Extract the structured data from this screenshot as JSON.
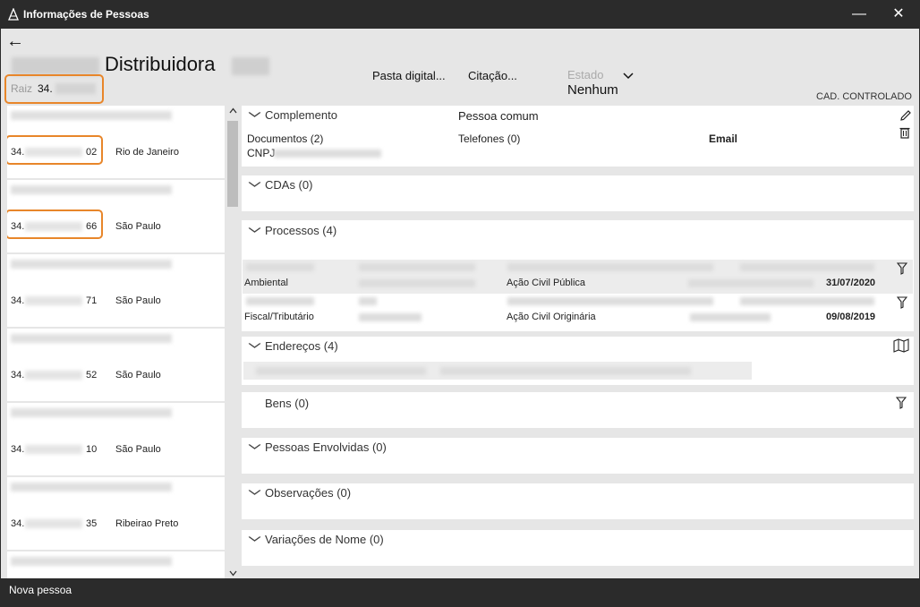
{
  "window": {
    "title": "Informações de Pessoas",
    "minimize_glyph": "—",
    "close_glyph": "✕"
  },
  "header": {
    "back_glyph": "←",
    "company_name_visible": "Distribuidora",
    "raiz_label": "Raiz",
    "raiz_value": "34."
  },
  "toolbar": {
    "pasta_digital": "Pasta digital...",
    "citacao": "Citação...",
    "estado_label": "Estado",
    "estado_value": "Nenhum",
    "cad_label": "CAD. CONTROLADO"
  },
  "list": {
    "items": [
      {
        "cnpj_prefix": "34.",
        "cnpj_suffix": "02",
        "city": "Rio de Janeiro",
        "highlighted": true
      },
      {
        "cnpj_prefix": "34.",
        "cnpj_suffix": "66",
        "city": "São Paulo",
        "highlighted": true
      },
      {
        "cnpj_prefix": "34.",
        "cnpj_suffix": "71",
        "city": "São Paulo",
        "highlighted": false
      },
      {
        "cnpj_prefix": "34.",
        "cnpj_suffix": "52",
        "city": "São Paulo",
        "highlighted": false
      },
      {
        "cnpj_prefix": "34.",
        "cnpj_suffix": "10",
        "city": "São Paulo",
        "highlighted": false
      },
      {
        "cnpj_prefix": "34.",
        "cnpj_suffix": "35",
        "city": "Ribeirao Preto",
        "highlighted": false
      }
    ]
  },
  "sections": {
    "complemento": {
      "title": "Complemento",
      "pessoa": "Pessoa comum",
      "documentos": "Documentos (2)",
      "telefones": "Telefones (0)",
      "email": "Email",
      "cnpj": "CNPJ"
    },
    "cdas": {
      "title": "CDAs (0)"
    },
    "processos": {
      "title": "Processos (4)",
      "rows": [
        {
          "area": "Ambiental",
          "acao": "Ação Civil Pública",
          "data": "31/07/2020"
        },
        {
          "area": "Fiscal/Tributário",
          "acao": "Ação Civil Originária",
          "data": "09/08/2019"
        }
      ]
    },
    "enderecos": {
      "title": "Endereços (4)"
    },
    "bens": {
      "title": "Bens (0)"
    },
    "pessoas_envolvidas": {
      "title": "Pessoas Envolvidas (0)"
    },
    "observacoes": {
      "title": "Observações (0)"
    },
    "variacoes": {
      "title": "Variações de Nome (0)"
    }
  },
  "status_bar": {
    "text": "Nova pessoa"
  },
  "icons": {
    "chevron_down": "⌵",
    "edit": "✎",
    "delete": "🗑",
    "filter": "⛉",
    "map": "⛶",
    "scroll_up": "▲",
    "scroll_down": "▼"
  },
  "colors": {
    "highlight_orange": "#e8862a",
    "titlebar": "#2b2b2b",
    "background": "#e6e6e6"
  }
}
